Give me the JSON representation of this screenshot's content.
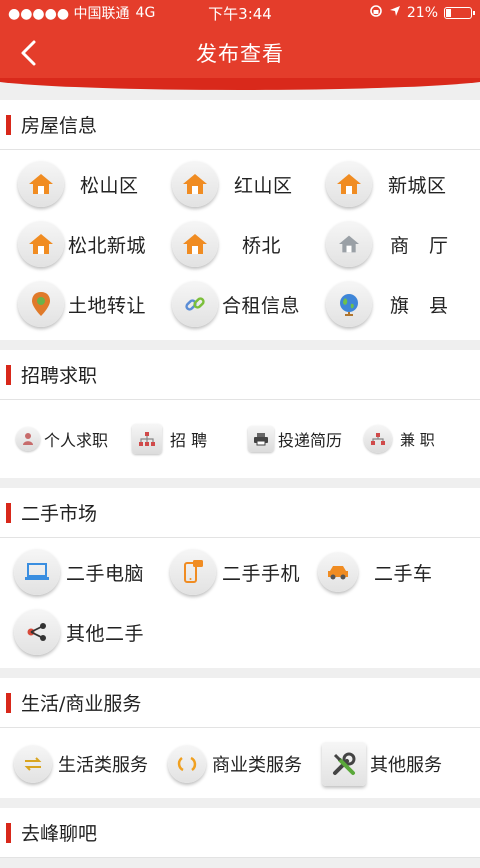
{
  "status": {
    "signal": "●●●●● 中国联通",
    "network": "4G",
    "time": "下午3:44",
    "battery_text": "21%",
    "battery_level": 0.21
  },
  "nav": {
    "title": "发布查看",
    "back_icon": "chevron-left-icon"
  },
  "colors": {
    "brand": "#e43d2b",
    "accent_bar": "#d8281a",
    "house_orange": "#f08c22"
  },
  "sections": {
    "housing": {
      "title": "房屋信息",
      "items": [
        "松山区",
        "红山区",
        "新城区",
        "松北新城",
        "桥北",
        "商　厅",
        "土地转让",
        "合租信息",
        "旗　县"
      ]
    },
    "jobs": {
      "title": "招聘求职",
      "items": [
        "个人求职",
        "招 聘",
        "投递简历",
        "兼 职"
      ]
    },
    "secondhand": {
      "title": "二手市场",
      "items": [
        "二手电脑",
        "二手手机",
        "二手车",
        "其他二手"
      ]
    },
    "services": {
      "title": "生活/商业服务",
      "items": [
        "生活类服务",
        "商业类服务",
        "其他服务"
      ]
    },
    "chat": {
      "title": "去峰聊吧"
    }
  }
}
